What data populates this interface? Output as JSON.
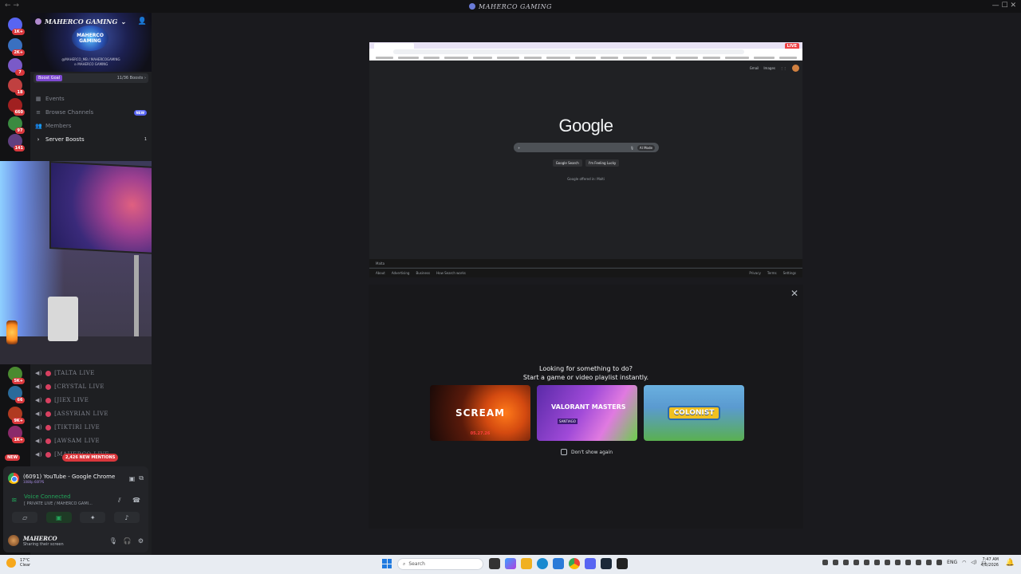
{
  "window": {
    "title": "MAHERCO GAMING",
    "nav_arrows": "← →",
    "controls": "— ☐ ✕"
  },
  "server": {
    "name": "MAHERCO GAMING",
    "banner_logo_line1": "MAHERCO",
    "banner_logo_line2": "GAMING",
    "banner_sub1": "@MAHERCO_MB  /  MAHERCOGAMING",
    "banner_sub2": "⊙ MAHERCO GAMING",
    "boost_goal_label": "Boost Goal",
    "boost_count": "11/36 Boosts ›"
  },
  "rail_badges": [
    "1K+",
    "2K+",
    "7",
    "18",
    "660",
    "97",
    "141",
    "5K+",
    "66",
    "9K+",
    "1K+",
    "NEW"
  ],
  "channels": [
    {
      "label": "Events",
      "icon": "▦"
    },
    {
      "label": "Browse Channels",
      "icon": "≡",
      "tag": "NEW"
    },
    {
      "label": "Members",
      "icon": "👥"
    },
    {
      "label": "Server Boosts",
      "icon": "›",
      "count": "1"
    }
  ],
  "voice_channels": [
    "[TALTA LIVE",
    "[CRYSTAL LIVE",
    "[JIEX LIVE",
    "[ASSYRIAN LIVE",
    "[TIKTIRI LIVE",
    "[AWSAM LIVE",
    "[MAHERCO LIVE"
  ],
  "mentions_label": "2,426 NEW MENTIONS",
  "new_label": "NEW",
  "stream": {
    "title": "(6091) YouTube - Google Chrome",
    "sub": "1080p 60FPS"
  },
  "voice": {
    "status": "Voice Connected",
    "where": "[ PRIVATE LIVE / MAHERCO GAMI..."
  },
  "user": {
    "name": "MAHERCO",
    "status": "Sharing their screen"
  },
  "google": {
    "logo": "Google",
    "search_placeholder": "+",
    "ai_mode": "AI Mode",
    "btn_search": "Google Search",
    "btn_lucky": "I'm Feeling Lucky",
    "offered": "Google offered in: Malti",
    "footer_country": "Malta",
    "footer_left": [
      "About",
      "Advertising",
      "Business",
      "How Search works"
    ],
    "footer_right": [
      "Privacy",
      "Terms",
      "Settings"
    ],
    "top_links": [
      "Gmail",
      "Images"
    ],
    "live": "LIVE"
  },
  "activity": {
    "title_line1": "Looking for something to do?",
    "title_line2": "Start a game or video playlist instantly.",
    "cards": [
      {
        "name": "SCREAM",
        "extra": "05.27.26"
      },
      {
        "name": "VALORANT MASTERS",
        "extra": "SANTIAGO"
      },
      {
        "name": "COLONIST",
        "extra": ""
      }
    ],
    "dont_show": "Don't show again"
  },
  "taskbar": {
    "temp": "17°C",
    "weather": "Clear",
    "search": "Search",
    "lang": "ENG",
    "time": "7:47 AM",
    "date": "4/6/2026"
  }
}
